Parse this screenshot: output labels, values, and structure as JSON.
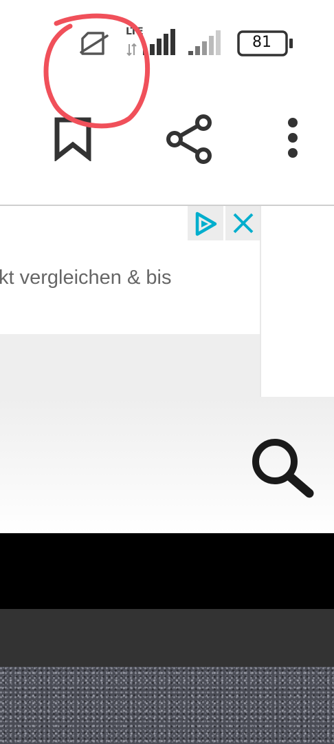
{
  "status_bar": {
    "network_type": "LTE",
    "battery_level": "81",
    "icons": [
      "no-sim-icon",
      "lte-icon",
      "signal-strength-icon",
      "signal-strength-icon",
      "battery-icon"
    ]
  },
  "toolbar": {
    "icons": [
      "bookmark-icon",
      "share-icon",
      "more-options-icon"
    ]
  },
  "ad": {
    "text": "kt vergleichen & bis",
    "icons": [
      "ad-choices-icon",
      "close-icon"
    ],
    "accent_color": "#00aecd"
  },
  "site_header": {
    "icons": [
      "search-icon"
    ]
  },
  "annotation": {
    "color": "#f0505a"
  }
}
